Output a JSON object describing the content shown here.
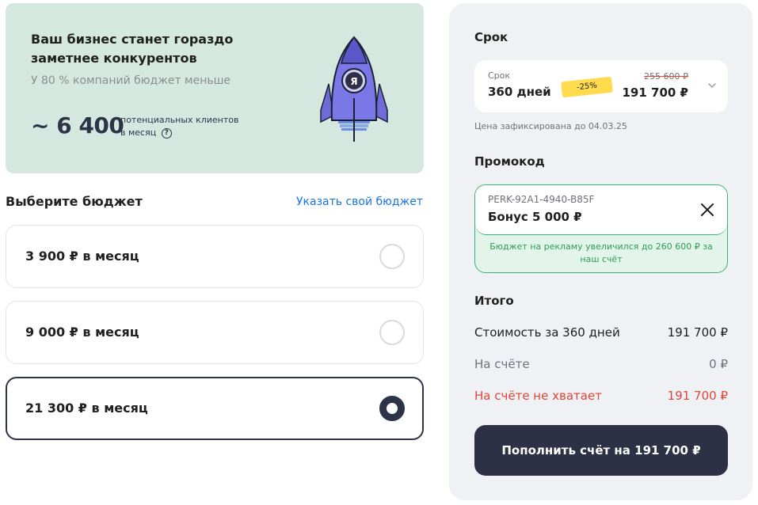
{
  "banner": {
    "title": "Ваш бизнес станет гораздо заметнее конкурентов",
    "subtitle": "У 80 % компаний бюджет меньше",
    "clients_number": "~ 6 400",
    "clients_caption_line1": "потенциальных клиентов",
    "clients_caption_line2": "в месяц",
    "info_icon": "?",
    "rocket_badge": "Я"
  },
  "budget": {
    "title": "Выберите бюджет",
    "custom_link": "Указать свой бюджет",
    "options": [
      {
        "label": "3 900 ₽ в месяц",
        "selected": false
      },
      {
        "label": "9 000 ₽ в месяц",
        "selected": false
      },
      {
        "label": "21 300 ₽ в месяц",
        "selected": true
      }
    ]
  },
  "term": {
    "title": "Срок",
    "small_label": "Срок",
    "value": "360 дней",
    "discount": "-25%",
    "price_old": "255 600 ₽",
    "price_new": "191 700 ₽",
    "fixed_note": "Цена зафиксирована до 04.03.25"
  },
  "promo": {
    "title": "Промокод",
    "code": "PERK-92A1-4940-B85F",
    "value": "Бонус 5 000 ₽",
    "message": "Бюджет на рекламу увеличился до 260 600 ₽ за наш счёт"
  },
  "summary": {
    "title": "Итого",
    "rows": [
      {
        "label": "Стоимость за 360 дней",
        "value": "191 700 ₽"
      },
      {
        "label": "На счёте",
        "value": "0 ₽"
      },
      {
        "label": "На счёте не хватает",
        "value": "191 700 ₽"
      }
    ]
  },
  "pay_button": "Пополнить счёт на 191 700 ₽",
  "colors": {
    "banner_bg": "#d4e8df",
    "accent_dark": "#2e3045",
    "link": "#1a73e8",
    "discount_badge": "#ffdb4d",
    "success": "#3ab36b",
    "error": "#e0453a"
  }
}
